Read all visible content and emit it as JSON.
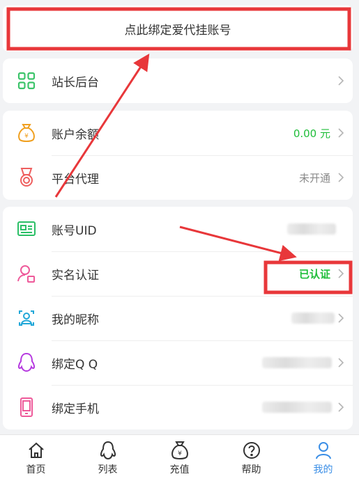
{
  "banner": {
    "text": "点此绑定爱代挂账号"
  },
  "card_admin": {
    "items": [
      {
        "label": "站长后台",
        "icon": "grid-icon"
      }
    ]
  },
  "card_account": {
    "items": [
      {
        "label": "账户余额",
        "value": "0.00 元",
        "icon": "money-bag-icon"
      },
      {
        "label": "平台代理",
        "value": "未开通",
        "icon": "medal-icon"
      }
    ]
  },
  "card_profile": {
    "items": [
      {
        "label": "账号UID",
        "icon": "id-card-icon"
      },
      {
        "label": "实名认证",
        "value": "已认证",
        "icon": "user-verify-icon"
      },
      {
        "label": "我的昵称",
        "icon": "profile-frame-icon"
      },
      {
        "label": "绑定Q Q",
        "icon": "qq-penguin-icon"
      },
      {
        "label": "绑定手机",
        "icon": "phone-icon"
      }
    ]
  },
  "tabbar": {
    "tabs": [
      {
        "label": "首页",
        "icon": "home-icon"
      },
      {
        "label": "列表",
        "icon": "penguin-icon"
      },
      {
        "label": "充值",
        "icon": "money-bag-icon"
      },
      {
        "label": "帮助",
        "icon": "help-icon"
      },
      {
        "label": "我的",
        "icon": "user-icon",
        "active": true
      }
    ]
  },
  "colors": {
    "accent_blue": "#3a8ee6",
    "green_value": "#1fbe3a",
    "annotation_red": "#e8373a"
  }
}
